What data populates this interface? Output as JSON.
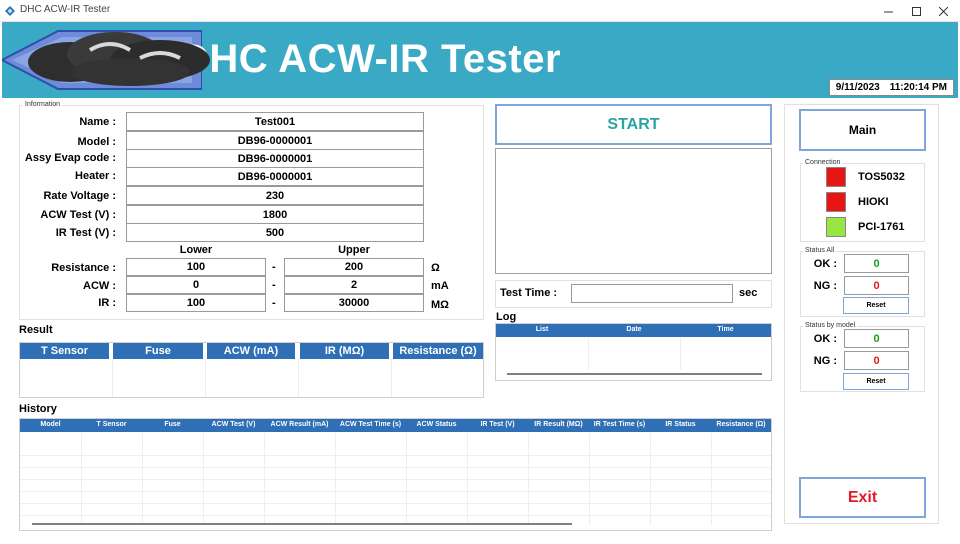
{
  "window": {
    "title": "DHC ACW-IR Tester"
  },
  "banner": {
    "title": "DHC ACW-IR Tester",
    "date": "9/11/2023",
    "time": "11:20:14 PM"
  },
  "information": {
    "caption": "Information",
    "fields": [
      {
        "label": "Name :",
        "value": "Test001"
      },
      {
        "label": "Model :",
        "value": "DB96-0000001"
      },
      {
        "label": "Assy Evap code :",
        "value": "DB96-0000001"
      },
      {
        "label": "Heater :",
        "value": "DB96-0000001"
      },
      {
        "label": "Rate Voltage :",
        "value": "230"
      },
      {
        "label": "ACW Test (V) :",
        "value": "1800"
      },
      {
        "label": "IR Test (V) :",
        "value": "500"
      }
    ],
    "lower_label": "Lower",
    "upper_label": "Upper",
    "ranges": [
      {
        "label": "Resistance :",
        "lower": "100",
        "upper": "200",
        "unit": "Ω"
      },
      {
        "label": "ACW :",
        "lower": "0",
        "upper": "2",
        "unit": "mA"
      },
      {
        "label": "IR :",
        "lower": "100",
        "upper": "30000",
        "unit": "MΩ"
      }
    ],
    "dash": "-"
  },
  "result": {
    "title": "Result",
    "columns": [
      "T Sensor",
      "Fuse",
      "ACW (mA)",
      "IR (MΩ)",
      "Resistance (Ω)"
    ]
  },
  "history": {
    "title": "History",
    "columns": [
      "Model",
      "T Sensor",
      "Fuse",
      "ACW Test (V)",
      "ACW Result (mA)",
      "ACW Test Time (s)",
      "ACW Status",
      "IR Test (V)",
      "IR Result (MΩ)",
      "IR Test Time (s)",
      "IR Status",
      "Resistance (Ω)"
    ]
  },
  "controls": {
    "start_label": "START",
    "test_time_label": "Test Time :",
    "test_time_value": "",
    "sec_label": "sec"
  },
  "log": {
    "title": "Log",
    "columns": [
      "List",
      "Date",
      "Time"
    ]
  },
  "side": {
    "main_label": "Main",
    "exit_label": "Exit",
    "connection_caption": "Connection",
    "connections": [
      {
        "name": "TOS5032",
        "color": "#e81515"
      },
      {
        "name": "HIOKI",
        "color": "#e81515"
      },
      {
        "name": "PCI-1761",
        "color": "#98e640"
      }
    ],
    "status_all": {
      "caption": "Status All",
      "ok_label": "OK :",
      "ok_value": "0",
      "ng_label": "NG :",
      "ng_value": "0",
      "reset_label": "Reset"
    },
    "status_model": {
      "caption": "Status by model",
      "ok_label": "OK :",
      "ok_value": "0",
      "ng_label": "NG :",
      "ng_value": "0",
      "reset_label": "Reset"
    }
  },
  "colors": {
    "banner": "#3aa9c6",
    "header": "#2e6fb6",
    "start_text": "#2ba3a3",
    "ok": "#1a9e1a",
    "ng": "#e01b1b",
    "exit_text": "#e01b2a"
  }
}
